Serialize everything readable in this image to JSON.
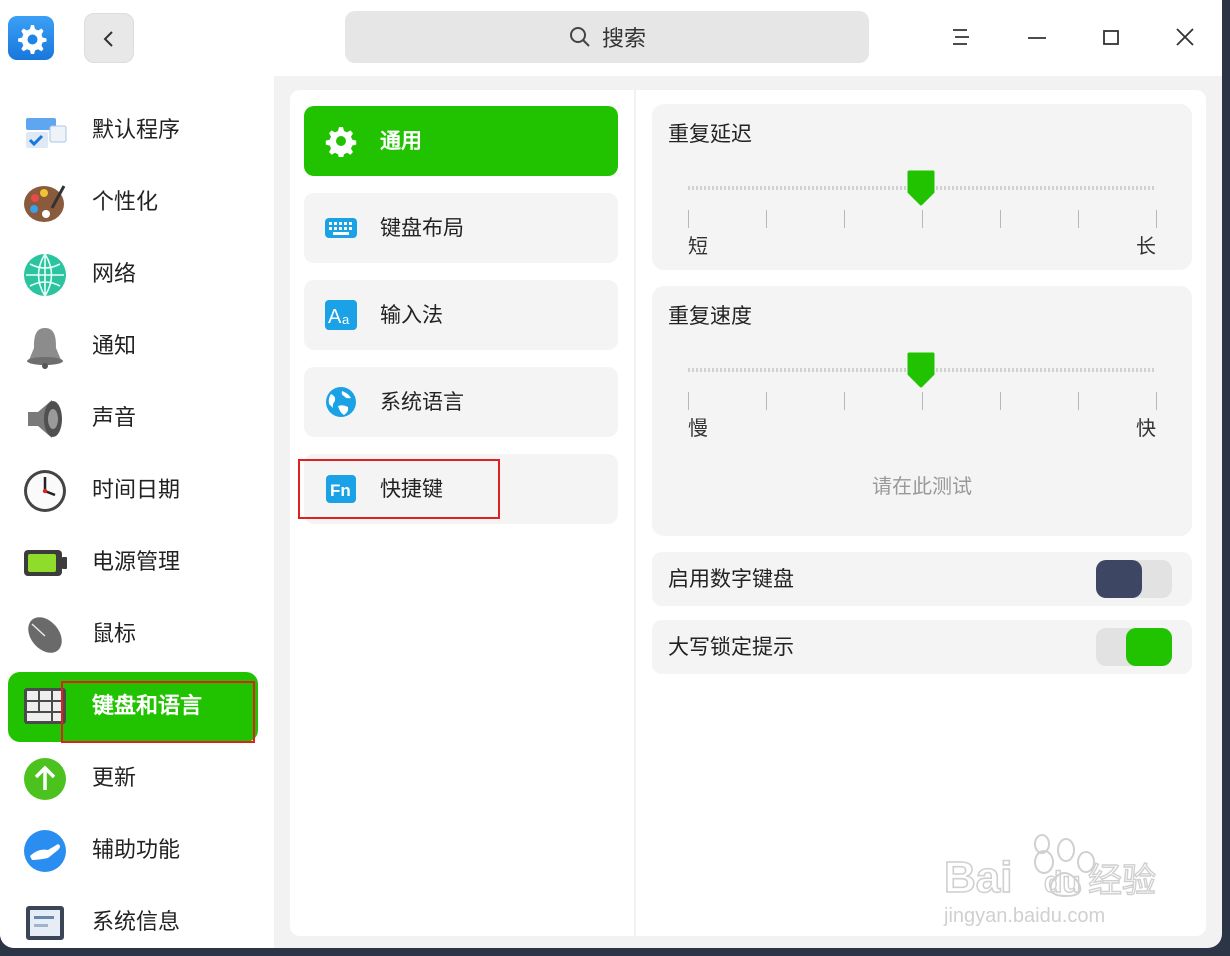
{
  "search": {
    "placeholder": "搜索"
  },
  "sidebar": {
    "items": [
      {
        "label": "默认程序"
      },
      {
        "label": "个性化"
      },
      {
        "label": "网络"
      },
      {
        "label": "通知"
      },
      {
        "label": "声音"
      },
      {
        "label": "时间日期"
      },
      {
        "label": "电源管理"
      },
      {
        "label": "鼠标"
      },
      {
        "label": "键盘和语言",
        "active": true
      },
      {
        "label": "更新"
      },
      {
        "label": "辅助功能"
      },
      {
        "label": "系统信息"
      }
    ]
  },
  "submenu": {
    "items": [
      {
        "label": "通用",
        "active": true
      },
      {
        "label": "键盘布局"
      },
      {
        "label": "输入法"
      },
      {
        "label": "系统语言"
      },
      {
        "label": "快捷键"
      }
    ]
  },
  "settings": {
    "repeat_delay": {
      "title": "重复延迟",
      "min_label": "短",
      "max_label": "长",
      "value_fraction": 0.5
    },
    "repeat_rate": {
      "title": "重复速度",
      "min_label": "慢",
      "max_label": "快",
      "value_fraction": 0.5,
      "test_placeholder": "请在此测试"
    },
    "numlock": {
      "label": "启用数字键盘",
      "enabled": false
    },
    "capslock_hint": {
      "label": "大写锁定提示",
      "enabled": true
    }
  },
  "watermark": {
    "brand": "Bai",
    "brand2": "du",
    "suffix": "经验",
    "url": "jingyan.baidu.com"
  },
  "colors": {
    "accent": "#21c300",
    "toggle_off_knob": "#3d4663",
    "highlight": "#e02020"
  }
}
